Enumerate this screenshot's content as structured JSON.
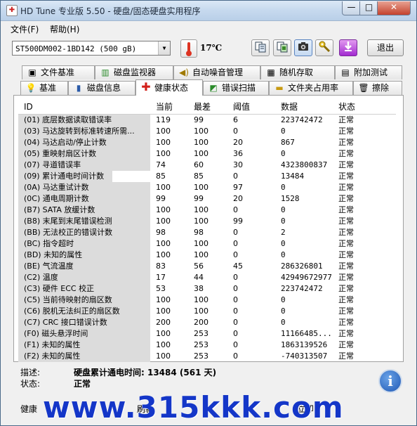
{
  "window": {
    "title": "HD Tune 专业版 5.50 - 硬盘/固态硬盘实用程序",
    "minimize": "—",
    "maximize": "□",
    "close": "✕"
  },
  "menu": {
    "file": "文件(F)",
    "help": "帮助(H)"
  },
  "toolbar": {
    "drive": "ST500DM002-1BD142 (500 gB)",
    "temperature": "17℃",
    "exit": "退出",
    "icons": [
      "copy-text-icon",
      "copy-screen-icon",
      "camera-icon",
      "options-key-icon",
      "download-icon"
    ]
  },
  "tabs_row1": [
    {
      "label": "文件基准",
      "icon": "file-benchmark-icon"
    },
    {
      "label": "磁盘监视器",
      "icon": "disk-monitor-icon"
    },
    {
      "label": "自动噪音管理",
      "icon": "speaker-icon"
    },
    {
      "label": "随机存取",
      "icon": "random-access-icon"
    },
    {
      "label": "附加测试",
      "icon": "extra-tests-icon"
    }
  ],
  "tabs_row2": [
    {
      "label": "基准",
      "icon": "benchmark-icon"
    },
    {
      "label": "磁盘信息",
      "icon": "disk-info-icon"
    },
    {
      "label": "健康状态",
      "icon": "health-cross-icon",
      "active": true
    },
    {
      "label": "错误扫描",
      "icon": "error-scan-icon"
    },
    {
      "label": "文件夹占用率",
      "icon": "folder-icon"
    },
    {
      "label": "擦除",
      "icon": "trash-icon"
    }
  ],
  "table": {
    "headers": {
      "id": "ID",
      "current": "当前",
      "worst": "最差",
      "threshold": "阈值",
      "data": "数据",
      "status": "状态"
    },
    "rows": [
      {
        "id": "(01) 底层数据读取错误率",
        "current": "119",
        "worst": "99",
        "threshold": "6",
        "data": "223742472",
        "status": "正常"
      },
      {
        "id": "(03) 马达旋转到标准转速所需...",
        "current": "100",
        "worst": "100",
        "threshold": "0",
        "data": "0",
        "status": "正常"
      },
      {
        "id": "(04) 马达启动/停止计数",
        "current": "100",
        "worst": "100",
        "threshold": "20",
        "data": "867",
        "status": "正常"
      },
      {
        "id": "(05) 重映射扇区计数",
        "current": "100",
        "worst": "100",
        "threshold": "36",
        "data": "0",
        "status": "正常"
      },
      {
        "id": "(07) 寻道错误率",
        "current": "74",
        "worst": "60",
        "threshold": "30",
        "data": "4323800837",
        "status": "正常"
      },
      {
        "id": "(09) 累计通电时间计数",
        "current": "85",
        "worst": "85",
        "threshold": "0",
        "data": "13484",
        "status": "正常",
        "selected": true
      },
      {
        "id": "(0A) 马达重试计数",
        "current": "100",
        "worst": "100",
        "threshold": "97",
        "data": "0",
        "status": "正常"
      },
      {
        "id": "(0C) 通电周期计数",
        "current": "99",
        "worst": "99",
        "threshold": "20",
        "data": "1528",
        "status": "正常"
      },
      {
        "id": "(B7) SATA 放缓计数",
        "current": "100",
        "worst": "100",
        "threshold": "0",
        "data": "0",
        "status": "正常"
      },
      {
        "id": "(B8) 末尾到末尾错误检测",
        "current": "100",
        "worst": "100",
        "threshold": "99",
        "data": "0",
        "status": "正常"
      },
      {
        "id": "(BB) 无法校正的错误计数",
        "current": "98",
        "worst": "98",
        "threshold": "0",
        "data": "2",
        "status": "正常"
      },
      {
        "id": "(BC) 指令超时",
        "current": "100",
        "worst": "100",
        "threshold": "0",
        "data": "0",
        "status": "正常"
      },
      {
        "id": "(BD) 未知的属性",
        "current": "100",
        "worst": "100",
        "threshold": "0",
        "data": "0",
        "status": "正常"
      },
      {
        "id": "(BE) 气流温度",
        "current": "83",
        "worst": "56",
        "threshold": "45",
        "data": "286326801",
        "status": "正常"
      },
      {
        "id": "(C2) 温度",
        "current": "17",
        "worst": "44",
        "threshold": "0",
        "data": "42949672977",
        "status": "正常"
      },
      {
        "id": "(C3) 硬件 ECC 校正",
        "current": "53",
        "worst": "38",
        "threshold": "0",
        "data": "223742472",
        "status": "正常"
      },
      {
        "id": "(C5) 当前待映射的扇区数",
        "current": "100",
        "worst": "100",
        "threshold": "0",
        "data": "0",
        "status": "正常"
      },
      {
        "id": "(C6) 脱机无法纠正的扇区数",
        "current": "100",
        "worst": "100",
        "threshold": "0",
        "data": "0",
        "status": "正常"
      },
      {
        "id": "(C7) CRC 接口错误计数",
        "current": "200",
        "worst": "200",
        "threshold": "0",
        "data": "0",
        "status": "正常"
      },
      {
        "id": "(F0) 磁头悬浮时间",
        "current": "100",
        "worst": "253",
        "threshold": "0",
        "data": "11166485...",
        "status": "正常"
      },
      {
        "id": "(F1) 未知的属性",
        "current": "100",
        "worst": "253",
        "threshold": "0",
        "data": "1863139526",
        "status": "正常"
      },
      {
        "id": "(F2) 未知的属性",
        "current": "100",
        "worst": "253",
        "threshold": "0",
        "data": "-740313507",
        "status": "正常"
      }
    ]
  },
  "description": {
    "desc_label": "描述:",
    "desc_value": "硬盘累计通电时间: 13484 (561 天)",
    "status_label": "状态:",
    "status_value": "正常"
  },
  "bottom": {
    "left_partial": "健康",
    "refresh_partial": "刷新",
    "update_partial": "立即"
  },
  "watermark": "www.315kkk.com"
}
